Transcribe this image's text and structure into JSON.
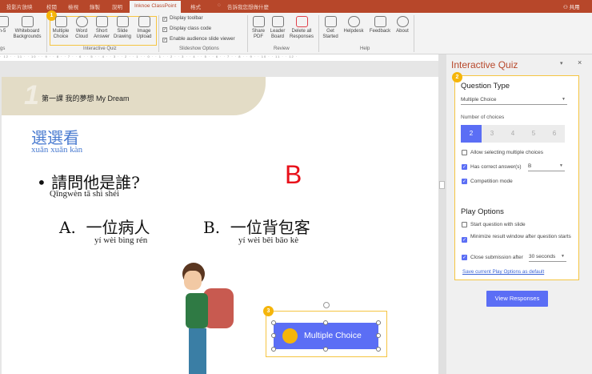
{
  "tabs": [
    "投影片放映",
    "校閱",
    "檢視",
    "錄製",
    "說明",
    "Inknoe ClassPoint",
    "格式",
    "告訴我您想做什麼"
  ],
  "share": "共用",
  "ribbon": {
    "left_partial": [
      "n-5",
      "Whiteboard Backgrounds"
    ],
    "left_group": "gs",
    "quiz_buttons": [
      "Multiple Choice",
      "Word Cloud",
      "Short Answer",
      "Slide Drawing",
      "Image Upload"
    ],
    "quiz_group": "Interactive Quiz",
    "slideshow_options": [
      "Display toolbar",
      "Display class code",
      "Enable audience slide viewer"
    ],
    "slideshow_group": "Slideshow Options",
    "review_buttons": [
      "Share PDF",
      "Leader Board",
      "Delete all Responses"
    ],
    "review_group": "Review",
    "help_buttons": [
      "Get Started",
      "Helpdesk",
      "Feedback",
      "About"
    ],
    "help_group": "Help"
  },
  "badges": [
    "1",
    "2",
    "3"
  ],
  "ruler": "· 12 · · 11 · · 10 · · 9 · · 8 · · 7 · · 6 · · 5 · · 4 · · 3 · · 2 · · 1 · · 0 · · 1 · · 2 · · 3 · · 4 · · 5 · · 6 · · 7 · · 8 · · 9 · · 10 · · 11 · · 12 ·",
  "slide": {
    "lesson_num": "1",
    "lesson_title": "第一課  我的夢想 My Dream",
    "heading": "選選看",
    "heading_pinyin": "xuǎn xuǎn kàn",
    "question": "請問他是誰?",
    "question_pinyin": "Qǐngwèn tā  shì  shéi",
    "option_a_label": "A.",
    "option_a": "一位病人",
    "option_a_pinyin": "yí wèi bìng rén",
    "option_b_label": "B.",
    "option_b": "一位背包客",
    "option_b_pinyin": "yí wèi bēi bāo kè",
    "answer_mark": "B",
    "quiz_button": "Multiple Choice"
  },
  "pane": {
    "title": "Interactive Quiz",
    "question_type_heading": "Question Type",
    "question_type": "Multiple Choice",
    "num_choices_label": "Number of choices",
    "choices": [
      "2",
      "3",
      "4",
      "5",
      "6"
    ],
    "selected_choice": "2",
    "allow_multiple": "Allow selecting multiple choices",
    "has_correct": "Has correct answer(s)",
    "correct_answer": "B",
    "competition": "Competition mode",
    "play_heading": "Play Options",
    "start_with_slide": "Start question with slide",
    "minimize": "Minimize result window after question starts",
    "close_after": "Close submission after",
    "close_value": "30 seconds",
    "save_default": "Save current Play Options as default",
    "view_responses": "View Responses"
  },
  "colors": {
    "accent": "#5b6ef5",
    "brand": "#b7472a",
    "highlight": "#f5b50a"
  }
}
